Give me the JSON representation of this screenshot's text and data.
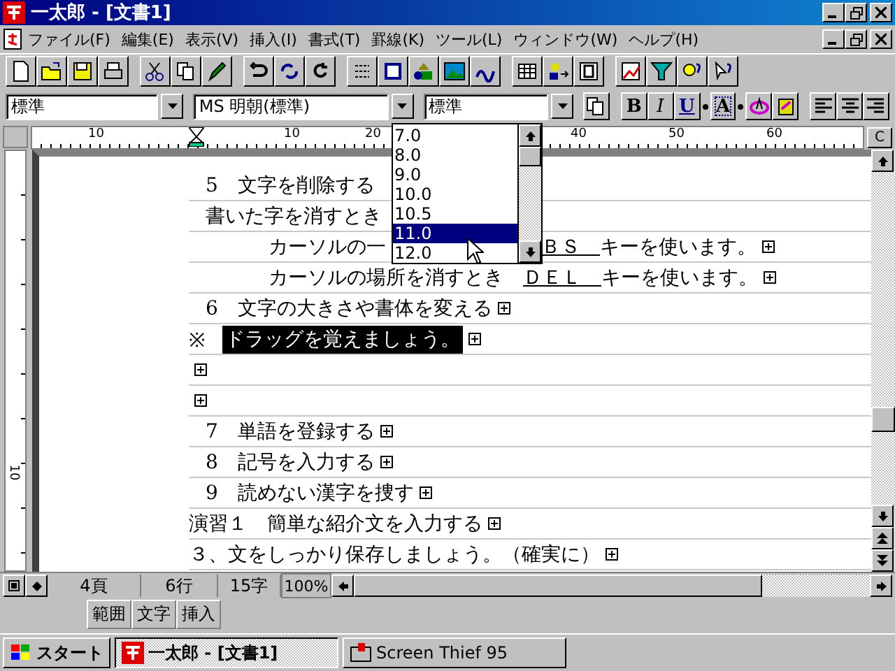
{
  "window": {
    "title": "一太郎 - [文書1]"
  },
  "menu": [
    "ファイル(F)",
    "編集(E)",
    "表示(V)",
    "挿入(I)",
    "書式(T)",
    "罫線(K)",
    "ツール(L)",
    "ウィンドウ(W)",
    "ヘルプ(H)"
  ],
  "format_bar": {
    "style": "標準",
    "font": "MS 明朝(標準)",
    "size": "標準",
    "buttons": [
      {
        "label": "B",
        "kind": "bold"
      },
      {
        "label": "I",
        "kind": "italic"
      },
      {
        "label": "U",
        "kind": "underline"
      },
      {
        "label": "A",
        "kind": "shade"
      }
    ]
  },
  "size_list": [
    {
      "label": "7.0",
      "selected": false
    },
    {
      "label": "8.0",
      "selected": false
    },
    {
      "label": "9.0",
      "selected": false
    },
    {
      "label": "10.0",
      "selected": false
    },
    {
      "label": "10.5",
      "selected": false
    },
    {
      "label": "11.0",
      "selected": true
    },
    {
      "label": "12.0",
      "selected": false
    }
  ],
  "ruler": {
    "labels": [
      "10",
      "10",
      "20",
      "40",
      "50",
      "60"
    ],
    "button": "C",
    "side_label": "10"
  },
  "document": [
    {
      "kind": "item",
      "end_mark": false,
      "segments": [
        {
          "text": "5　文字を削除する"
        }
      ]
    },
    {
      "kind": "item",
      "end_mark": false,
      "segments": [
        {
          "text": "書いた字を消すとき"
        }
      ]
    },
    {
      "kind": "detail",
      "end_mark": true,
      "segments": [
        {
          "text": "カーソルの一"
        },
        {
          "text": "ＢＳ　",
          "underline": true,
          "kind": "past-list"
        },
        {
          "text": "キーを使います。"
        }
      ]
    },
    {
      "kind": "detail",
      "end_mark": true,
      "segments": [
        {
          "text": "カーソルの場所を消すとき　"
        },
        {
          "text": "ＤＥＬ　",
          "underline": true
        },
        {
          "text": "キーを使います。"
        }
      ]
    },
    {
      "kind": "item",
      "end_mark": true,
      "segments": [
        {
          "text": "6　文字の大きさや書体を変える"
        }
      ]
    },
    {
      "kind": "flush",
      "end_mark": true,
      "segments": [
        {
          "text": "※"
        },
        {
          "text": "ドラッグを覚えましょう。",
          "highlighted": true
        }
      ]
    },
    {
      "kind": "flush",
      "end_mark": true
    },
    {
      "kind": "flush",
      "end_mark": true
    },
    {
      "kind": "item",
      "end_mark": true,
      "segments": [
        {
          "text": "7　単語を登録する"
        }
      ]
    },
    {
      "kind": "item",
      "end_mark": true,
      "segments": [
        {
          "text": "8　記号を入力する"
        }
      ]
    },
    {
      "kind": "item",
      "end_mark": true,
      "segments": [
        {
          "text": "9　読めない漢字を捜す"
        }
      ]
    },
    {
      "kind": "flush",
      "end_mark": true,
      "segments": [
        {
          "text": "演習１　簡単な紹介文を入力する"
        }
      ]
    },
    {
      "kind": "flush",
      "end_mark": true,
      "segments": [
        {
          "text": "３、文をしっかり保存しましょう。（確実に）"
        }
      ]
    }
  ],
  "status_bar": {
    "page": "4頁",
    "line": "6行",
    "column": "15字",
    "zoom": "100%"
  },
  "mode_buttons": [
    "範囲",
    "文字",
    "挿入"
  ],
  "taskbar": {
    "start": "スタート",
    "tasks": [
      {
        "label": "一太郎 - [文書1]",
        "selected": true
      },
      {
        "label": "Screen Thief 95",
        "selected": false
      }
    ]
  }
}
